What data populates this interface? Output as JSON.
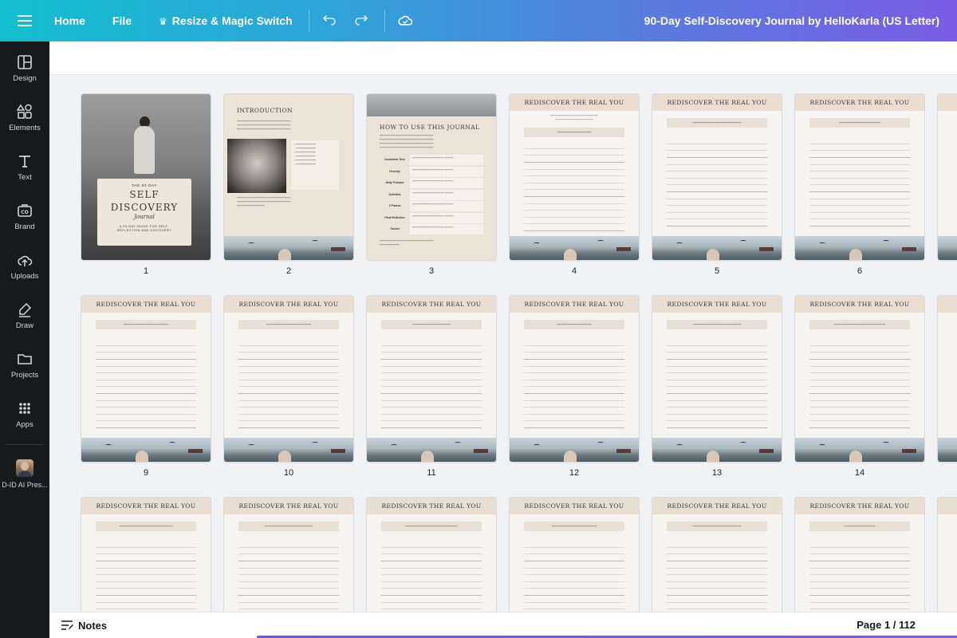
{
  "topbar": {
    "home": "Home",
    "file": "File",
    "resize": "Resize & Magic Switch",
    "doc_title": "90-Day Self-Discovery Journal by HelloKarla (US Letter)"
  },
  "sidebar": {
    "items": [
      {
        "label": "Design",
        "icon": "layout-icon"
      },
      {
        "label": "Elements",
        "icon": "shapes-icon"
      },
      {
        "label": "Text",
        "icon": "text-icon"
      },
      {
        "label": "Brand",
        "icon": "brand-icon"
      },
      {
        "label": "Uploads",
        "icon": "upload-cloud-icon"
      },
      {
        "label": "Draw",
        "icon": "pen-icon"
      },
      {
        "label": "Projects",
        "icon": "folder-icon"
      },
      {
        "label": "Apps",
        "icon": "grid-icon"
      },
      {
        "label": "D-ID AI Pres...",
        "icon": "avatar"
      }
    ]
  },
  "pages": {
    "cover": {
      "eyebrow": "THE 90-DAY",
      "title_line1": "SELF",
      "title_line2": "DISCOVERY",
      "script": "Journal",
      "subtitle": "A 90-DAY GUIDE FOR SELF-REFLECTION AND DISCOVERY"
    },
    "intro": {
      "title": "INTRODUCTION"
    },
    "howto": {
      "title": "HOW TO USE THIS JOURNAL",
      "rows": [
        "Consistent Time",
        "Honesty",
        "Daily Prompts",
        "Activities",
        "3 Phases",
        "Final Reflection",
        "Tracker"
      ]
    },
    "journal_heading": "REDISCOVER THE REAL YOU",
    "numbers": [
      "1",
      "2",
      "3",
      "4",
      "5",
      "6",
      "9",
      "10",
      "11",
      "12",
      "13",
      "14"
    ]
  },
  "bottombar": {
    "notes": "Notes",
    "page_indicator": "Page 1 / 112"
  },
  "colors": {
    "sidebar_bg": "#18191b",
    "page_head": "#e8dfd2",
    "accent": "#7a5ce5"
  }
}
